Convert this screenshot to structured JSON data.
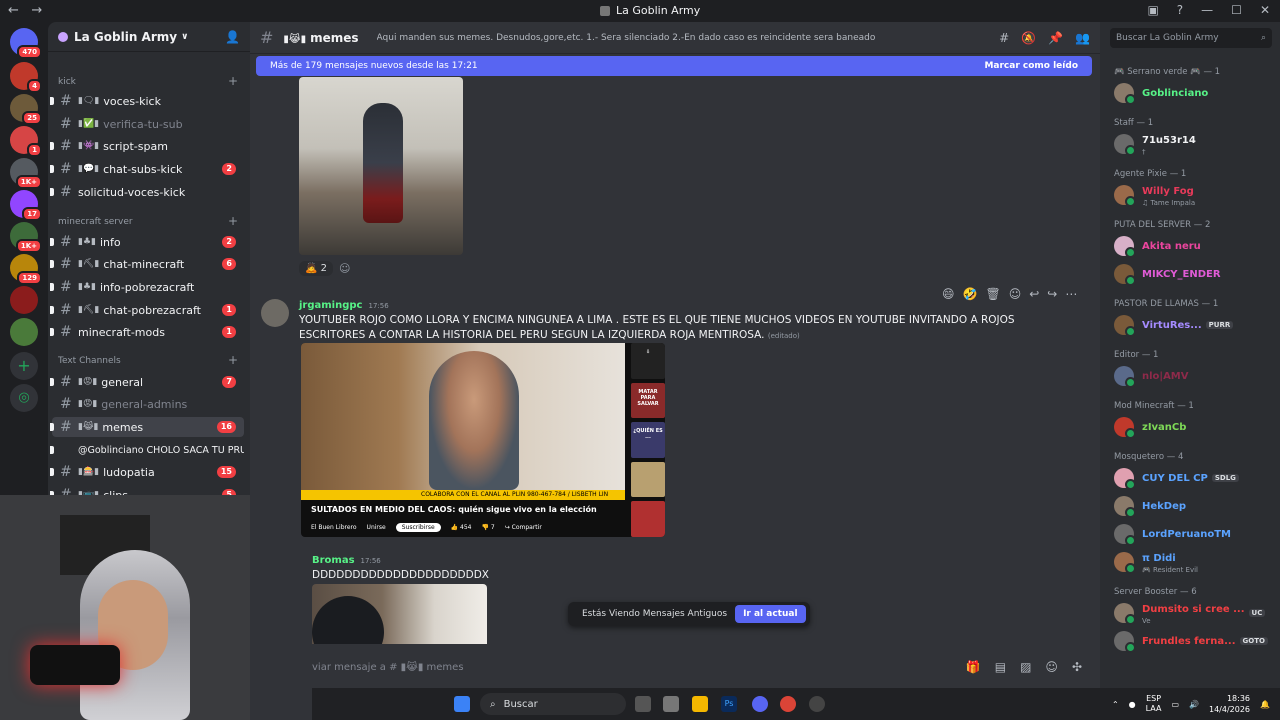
{
  "window": {
    "title": "La Goblin Army",
    "back": "←",
    "forward": "→"
  },
  "server_list": {
    "home_badge": "470",
    "servers": [
      {
        "name": "server-1",
        "badge": "4",
        "color": "#c0392b"
      },
      {
        "name": "server-2",
        "badge": "25",
        "color": "#6d5a3a"
      },
      {
        "name": "server-3",
        "badge": "1",
        "color": "#d64545"
      },
      {
        "name": "server-4",
        "badge": "1K+",
        "color": "#555a60"
      },
      {
        "name": "server-5",
        "badge": "17",
        "color": "#9146ff"
      },
      {
        "name": "server-6",
        "badge": "1K+",
        "color": "#3d6b3a"
      },
      {
        "name": "server-7",
        "badge": "129",
        "color": "#b8860b"
      },
      {
        "name": "server-8",
        "badge": "",
        "color": "#8b1c1c"
      },
      {
        "name": "server-9",
        "badge": "",
        "color": "#4a7a3a"
      }
    ]
  },
  "guild": {
    "name": "La Goblin Army",
    "chevron": "∨"
  },
  "categories": {
    "kick": "kick",
    "minecraft": "minecraft server",
    "text": "Text Channels"
  },
  "channels": [
    {
      "emoji": "▮🗨▮",
      "name": "voces-kick",
      "badge": "",
      "muted": false
    },
    {
      "emoji": "▮✅▮",
      "name": "verifica-tu-sub",
      "badge": "",
      "muted": true
    },
    {
      "emoji": "▮👾▮",
      "name": "script-spam",
      "badge": "",
      "muted": false
    },
    {
      "emoji": "▮💬▮",
      "name": "chat-subs-kick",
      "badge": "2",
      "muted": false
    },
    {
      "emoji": "",
      "name": "solicitud-voces-kick",
      "badge": "",
      "muted": false
    },
    {
      "emoji": "▮♣▮",
      "name": "info",
      "badge": "2",
      "muted": false
    },
    {
      "emoji": "▮⛏▮",
      "name": "chat-minecraft",
      "badge": "6",
      "muted": false
    },
    {
      "emoji": "▮♣▮",
      "name": "info-pobrezacraft",
      "badge": "",
      "muted": false
    },
    {
      "emoji": "▮⛏▮",
      "name": "chat-pobrezacraft",
      "badge": "1",
      "muted": false
    },
    {
      "emoji": "",
      "name": "minecraft-mods",
      "badge": "1",
      "muted": false
    },
    {
      "emoji": "▮😡▮",
      "name": "general",
      "badge": "7",
      "muted": false
    },
    {
      "emoji": "▮😡▮",
      "name": "general-admins",
      "badge": "",
      "muted": true
    },
    {
      "emoji": "▮😹▮",
      "name": "memes",
      "badge": "16",
      "muted": false
    },
    {
      "emoji": "",
      "name": "@Goblinciano CHOLO SACA TU PRUE...",
      "badge": "",
      "muted": false
    },
    {
      "emoji": "▮🎰▮",
      "name": "ludopatia",
      "badge": "15",
      "muted": false
    },
    {
      "emoji": "▮📺▮",
      "name": "clips",
      "badge": "5",
      "muted": false
    }
  ],
  "header": {
    "channel_name": "memes",
    "channel_emoji": "▮😹▮",
    "topic": "Aqui manden sus memes. Desnudos,gore,etc. 1.- Sera silenciado 2.-En dado caso es reincidente sera baneado"
  },
  "new_messages_bar": {
    "text": "Más de 179 mensajes nuevos desde las 17:21",
    "action": "Marcar como leído"
  },
  "messages": [
    {
      "reaction_count": "2"
    },
    {
      "author": "jrgamingpc",
      "time": "17:56",
      "text": "YOUTUBER ROJO COMO LLORA Y ENCIMA NINGUNEA A LIMA . ESTE ES EL QUE TIENE MUCHOS VIDEOS EN YOUTUBE INVITANDO A ROJOS ESCRITORES A CONTAR LA HISTORIA DEL PERU SEGUN LA IZQUIERDA ROJA MENTIROSA.",
      "edited": "(editado)",
      "embed": {
        "ticker": "COLABORA CON EL CANAL AL PLIN 980-467-784 / LISBETH LIN",
        "title": "SULTADOS EN MEDIO DEL CAOS: quién sigue vivo en la elección",
        "channel": "El Buen Librero",
        "join": "Unirse",
        "subscribe": "Suscribirse",
        "likes": "454",
        "dislikes": "7",
        "share": "Compartir",
        "side": [
          "",
          "MATAR PARA SALVAR",
          "¿QUIÉN ES ...",
          "",
          ""
        ]
      }
    },
    {
      "author": "Bromas",
      "time": "17:56",
      "text": "DDDDDDDDDDDDDDDDDDDDDX"
    }
  ],
  "old_messages": {
    "text": "Estás Viendo Mensajes Antiguos",
    "button": "Ir al actual"
  },
  "composer": {
    "placeholder": "viar mensaje a #  ▮😹▮  memes"
  },
  "members_search": {
    "placeholder": "Buscar La Goblin Army"
  },
  "roles": [
    {
      "label": "🎮 Serrano verde 🎮 — 1",
      "members": [
        {
          "name": "Goblinciano",
          "color": "#57f287",
          "sub": "",
          "tag": ""
        }
      ]
    },
    {
      "label": "Staff — 1",
      "members": [
        {
          "name": "71u53r14",
          "color": "#f2f3f5",
          "sub": "†",
          "tag": ""
        }
      ]
    },
    {
      "label": "Agente Pixie — 1",
      "members": [
        {
          "name": "Willy Fog",
          "color": "#e83a5a",
          "sub": "♫ Tame Impala",
          "tag": ""
        }
      ]
    },
    {
      "label": "PUTA DEL SERVER — 2",
      "members": [
        {
          "name": "Akita neru",
          "color": "#eb459e",
          "sub": "",
          "tag": ""
        },
        {
          "name": "MIKCY_ENDER",
          "color": "#e05bd6",
          "sub": "",
          "tag": ""
        }
      ]
    },
    {
      "label": "PASTOR DE LLAMAS — 1",
      "members": [
        {
          "name": "VirtuRes...",
          "color": "#a58bff",
          "sub": "",
          "tag": "PURR"
        }
      ]
    },
    {
      "label": "Editor — 1",
      "members": [
        {
          "name": "nlo|AMV",
          "color": "#8e2a4a",
          "sub": "",
          "tag": ""
        }
      ]
    },
    {
      "label": "Mod Minecraft — 1",
      "members": [
        {
          "name": "zIvanCb",
          "color": "#7ed957",
          "sub": "",
          "tag": ""
        }
      ]
    },
    {
      "label": "Mosquetero — 4",
      "members": [
        {
          "name": "CUY DEL CP",
          "color": "#5ba3ff",
          "sub": "",
          "tag": "SDLG"
        },
        {
          "name": "HekDep",
          "color": "#5ba3ff",
          "sub": "",
          "tag": ""
        },
        {
          "name": "LordPeruanoTM",
          "color": "#5ba3ff",
          "sub": "",
          "tag": ""
        },
        {
          "name": "π Didi",
          "color": "#5ba3ff",
          "sub": "🎮 Resident Evil",
          "tag": ""
        }
      ]
    },
    {
      "label": "Server Booster — 6",
      "members": [
        {
          "name": "Dumsito si cree ...",
          "color": "#f23f43",
          "sub": "Ve",
          "tag": "UC"
        },
        {
          "name": "Frundles ferna...",
          "color": "#f23f43",
          "sub": "",
          "tag": "GOTO"
        }
      ]
    }
  ],
  "taskbar": {
    "search": "Buscar",
    "lang": "ESP",
    "layout": "LAA",
    "time": "18:36",
    "date": "14/4/2026"
  }
}
